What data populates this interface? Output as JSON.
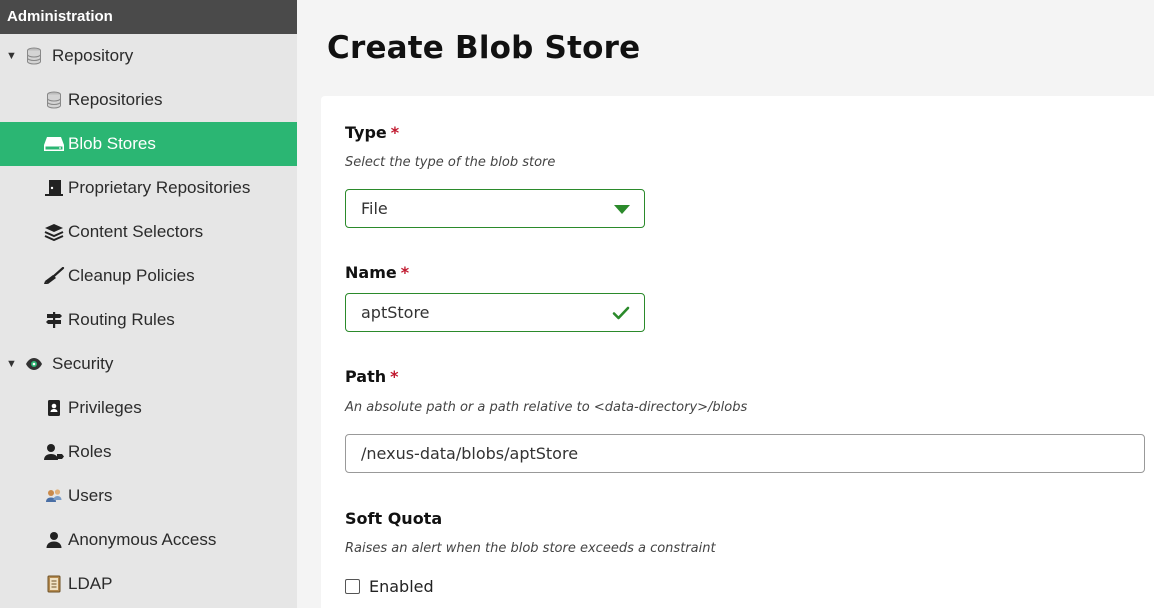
{
  "sidebar": {
    "header": "Administration",
    "items": [
      {
        "label": "Repository"
      },
      {
        "label": "Repositories"
      },
      {
        "label": "Blob Stores"
      },
      {
        "label": "Proprietary Repositories"
      },
      {
        "label": "Content Selectors"
      },
      {
        "label": "Cleanup Policies"
      },
      {
        "label": "Routing Rules"
      },
      {
        "label": "Security"
      },
      {
        "label": "Privileges"
      },
      {
        "label": "Roles"
      },
      {
        "label": "Users"
      },
      {
        "label": "Anonymous Access"
      },
      {
        "label": "LDAP"
      }
    ]
  },
  "main": {
    "title": "Create Blob Store",
    "type": {
      "label": "Type",
      "required": "*",
      "help": "Select the type of the blob store",
      "value": "File"
    },
    "name": {
      "label": "Name",
      "required": "*",
      "value": "aptStore"
    },
    "path": {
      "label": "Path",
      "required": "*",
      "help": "An absolute path or a path relative to <data-directory>/blobs",
      "value": "/nexus-data/blobs/aptStore"
    },
    "soft_quota": {
      "label": "Soft Quota",
      "help": "Raises an alert when the blob store exceeds a constraint",
      "enabled_label": "Enabled"
    }
  },
  "colors": {
    "active": "#2bb673",
    "valid": "#2b8a2b",
    "required": "#c0172d"
  }
}
